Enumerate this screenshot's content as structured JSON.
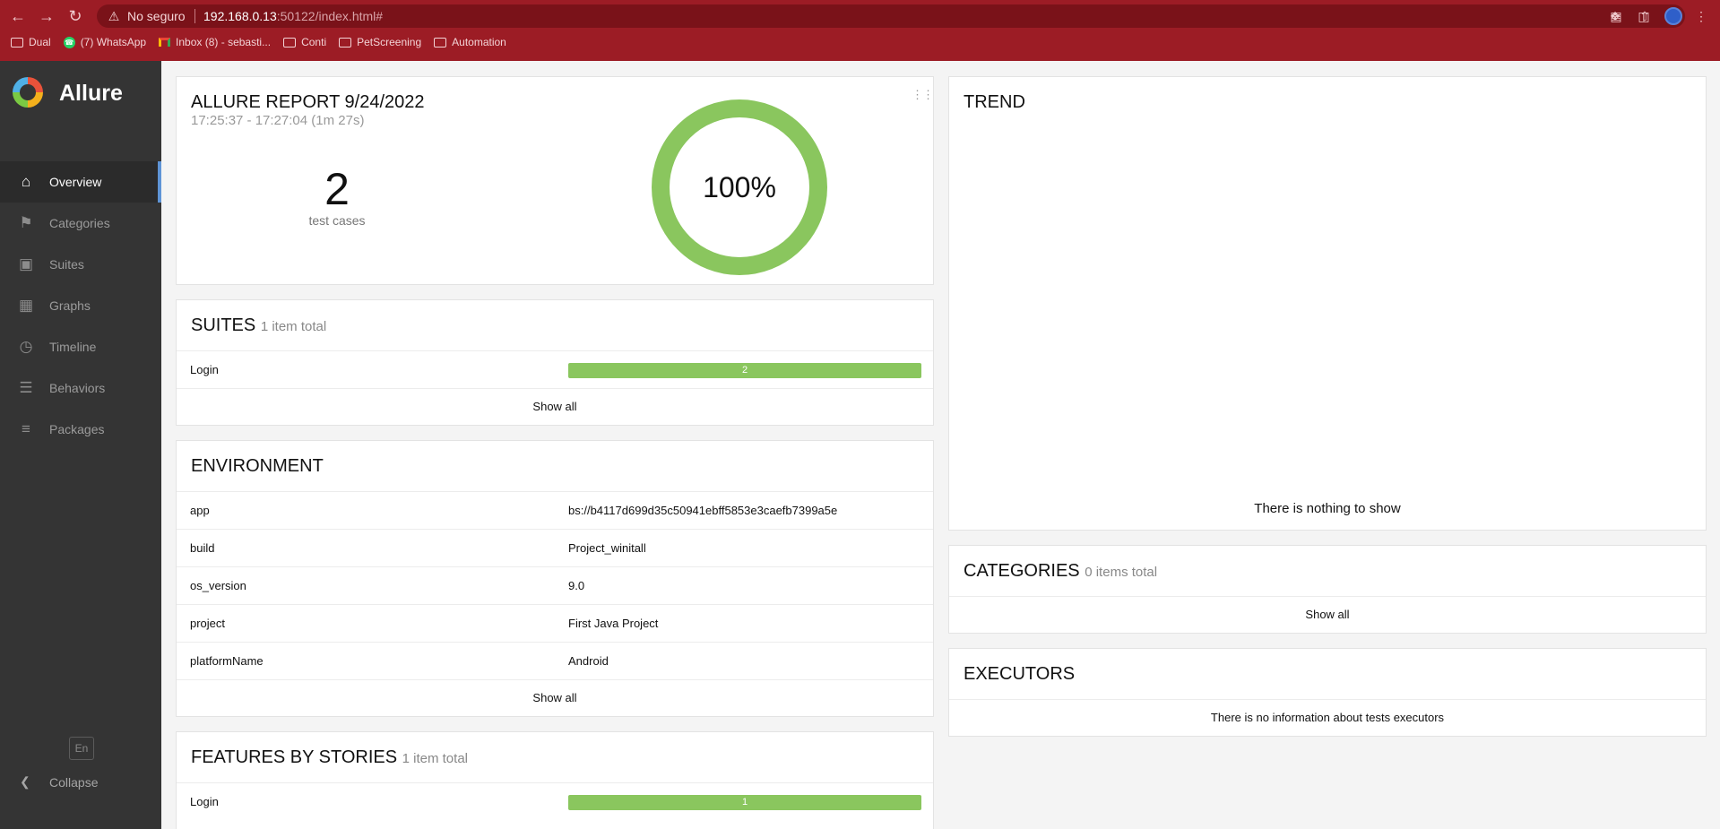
{
  "browser": {
    "security_label": "No seguro",
    "url_host": "192.168.0.13",
    "url_rest": ":50122/index.html#",
    "bookmarks": [
      "Dual",
      "(7) WhatsApp",
      "Inbox (8) - sebasti...",
      "Conti",
      "PetScreening",
      "Automation"
    ]
  },
  "sidebar": {
    "app_name": "Allure",
    "items": [
      {
        "label": "Overview",
        "icon": "home-icon",
        "active": true
      },
      {
        "label": "Categories",
        "icon": "flag-icon"
      },
      {
        "label": "Suites",
        "icon": "briefcase-icon"
      },
      {
        "label": "Graphs",
        "icon": "bar-chart-icon"
      },
      {
        "label": "Timeline",
        "icon": "clock-icon"
      },
      {
        "label": "Behaviors",
        "icon": "list-icon"
      },
      {
        "label": "Packages",
        "icon": "align-left-icon"
      }
    ],
    "language": "En",
    "collapse_label": "Collapse"
  },
  "summary": {
    "title": "ALLURE REPORT 9/24/2022",
    "time_range": "17:25:37 - 17:27:04 (1m 27s)",
    "test_count": "2",
    "test_count_label": "test cases",
    "pass_rate": "100%",
    "pass_color": "#8ac65e"
  },
  "suites": {
    "title": "SUITES",
    "subtitle": "1 item total",
    "rows": [
      {
        "name": "Login",
        "count": "2"
      }
    ],
    "show_all": "Show all"
  },
  "environment": {
    "title": "ENVIRONMENT",
    "rows": [
      {
        "key": "app",
        "value": "bs://b4117d699d35c50941ebff5853e3caefb7399a5e"
      },
      {
        "key": "build",
        "value": "Project_winitall"
      },
      {
        "key": "os_version",
        "value": "9.0"
      },
      {
        "key": "project",
        "value": "First Java Project"
      },
      {
        "key": "platformName",
        "value": "Android"
      }
    ],
    "show_all": "Show all"
  },
  "features": {
    "title": "FEATURES BY STORIES",
    "subtitle": "1 item total",
    "rows": [
      {
        "name": "Login",
        "count": "1"
      }
    ]
  },
  "trend": {
    "title": "TREND",
    "empty": "There is nothing to show"
  },
  "categories": {
    "title": "CATEGORIES",
    "subtitle": "0 items total",
    "show_all": "Show all"
  },
  "executors": {
    "title": "EXECUTORS",
    "empty": "There is no information about tests executors"
  }
}
